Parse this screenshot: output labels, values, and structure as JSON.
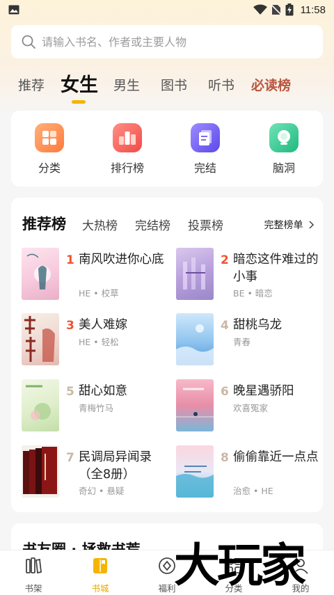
{
  "status_bar": {
    "time": "11:58"
  },
  "search": {
    "placeholder": "请输入书名、作者或主要人物"
  },
  "tabs": [
    {
      "label": "推荐"
    },
    {
      "label": "女生"
    },
    {
      "label": "男生"
    },
    {
      "label": "图书"
    },
    {
      "label": "听书"
    },
    {
      "label": "必读榜"
    }
  ],
  "categories": [
    {
      "label": "分类",
      "icon": "grid-icon",
      "color": "#ff8a3d"
    },
    {
      "label": "排行榜",
      "icon": "ranking-icon",
      "color": "#f25c54"
    },
    {
      "label": "完结",
      "icon": "document-icon",
      "color": "#6a5cf0"
    },
    {
      "label": "脑洞",
      "icon": "bulb-icon",
      "color": "#2ec28a"
    }
  ],
  "ranking": {
    "tabs": [
      {
        "label": "推荐榜"
      },
      {
        "label": "大热榜"
      },
      {
        "label": "完结榜"
      },
      {
        "label": "投票榜"
      }
    ],
    "full_list_label": "完整榜单",
    "books": [
      {
        "rank": "1",
        "title": "南风吹进你心底",
        "tags": "HE • 校草"
      },
      {
        "rank": "2",
        "title": "暗恋这件难过的小事",
        "tags": "BE • 暗恋"
      },
      {
        "rank": "3",
        "title": "美人难嫁",
        "tags": "HE • 轻松"
      },
      {
        "rank": "4",
        "title": "甜桃乌龙",
        "tags": "青春"
      },
      {
        "rank": "5",
        "title": "甜心如意",
        "tags": "青梅竹马"
      },
      {
        "rank": "6",
        "title": "晚星遇骄阳",
        "tags": "欢喜冤家"
      },
      {
        "rank": "7",
        "title": "民调局异闻录（全8册）",
        "tags": "奇幻 • 悬疑"
      },
      {
        "rank": "8",
        "title": "偷偷靠近一点点",
        "tags": "治愈 • HE"
      }
    ],
    "rank_colors": {
      "top": "#f0532e",
      "other": "#c9b8a6"
    }
  },
  "next_section": {
    "title": "书友圈 · 拯救书荒"
  },
  "bottom_nav": [
    {
      "label": "书架",
      "icon": "bookshelf-icon"
    },
    {
      "label": "书城",
      "icon": "book-icon"
    },
    {
      "label": "福利",
      "icon": "reward-icon"
    },
    {
      "label": "分类",
      "icon": "category-icon"
    },
    {
      "label": "我的",
      "icon": "profile-icon"
    }
  ],
  "watermark": {
    "text": "大玩家"
  },
  "accent": "#f5b400"
}
